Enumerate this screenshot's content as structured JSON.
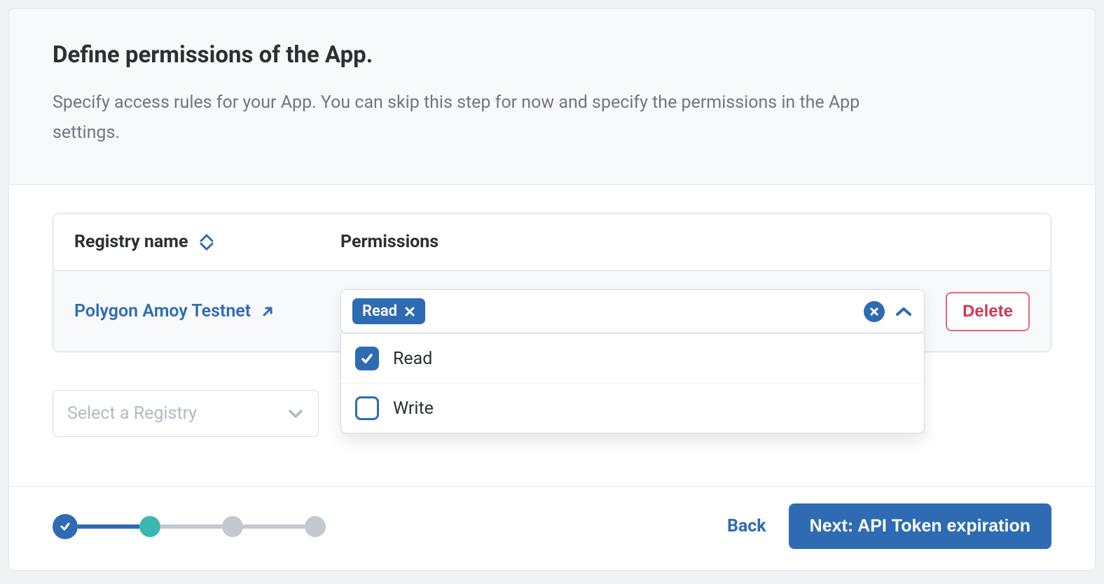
{
  "header": {
    "title": "Define permissions of the App.",
    "subtitle": "Specify access rules for your App. You can skip this step for now and specify the permissions in the App settings."
  },
  "table": {
    "col_registry": "Registry name",
    "col_permissions": "Permissions",
    "row": {
      "registry": "Polygon Amoy Testnet",
      "chip": "Read",
      "options": {
        "read": "Read",
        "write": "Write"
      },
      "delete": "Delete"
    }
  },
  "select_placeholder": "Select a Registry",
  "footer": {
    "back": "Back",
    "next": "Next: API Token expiration"
  }
}
